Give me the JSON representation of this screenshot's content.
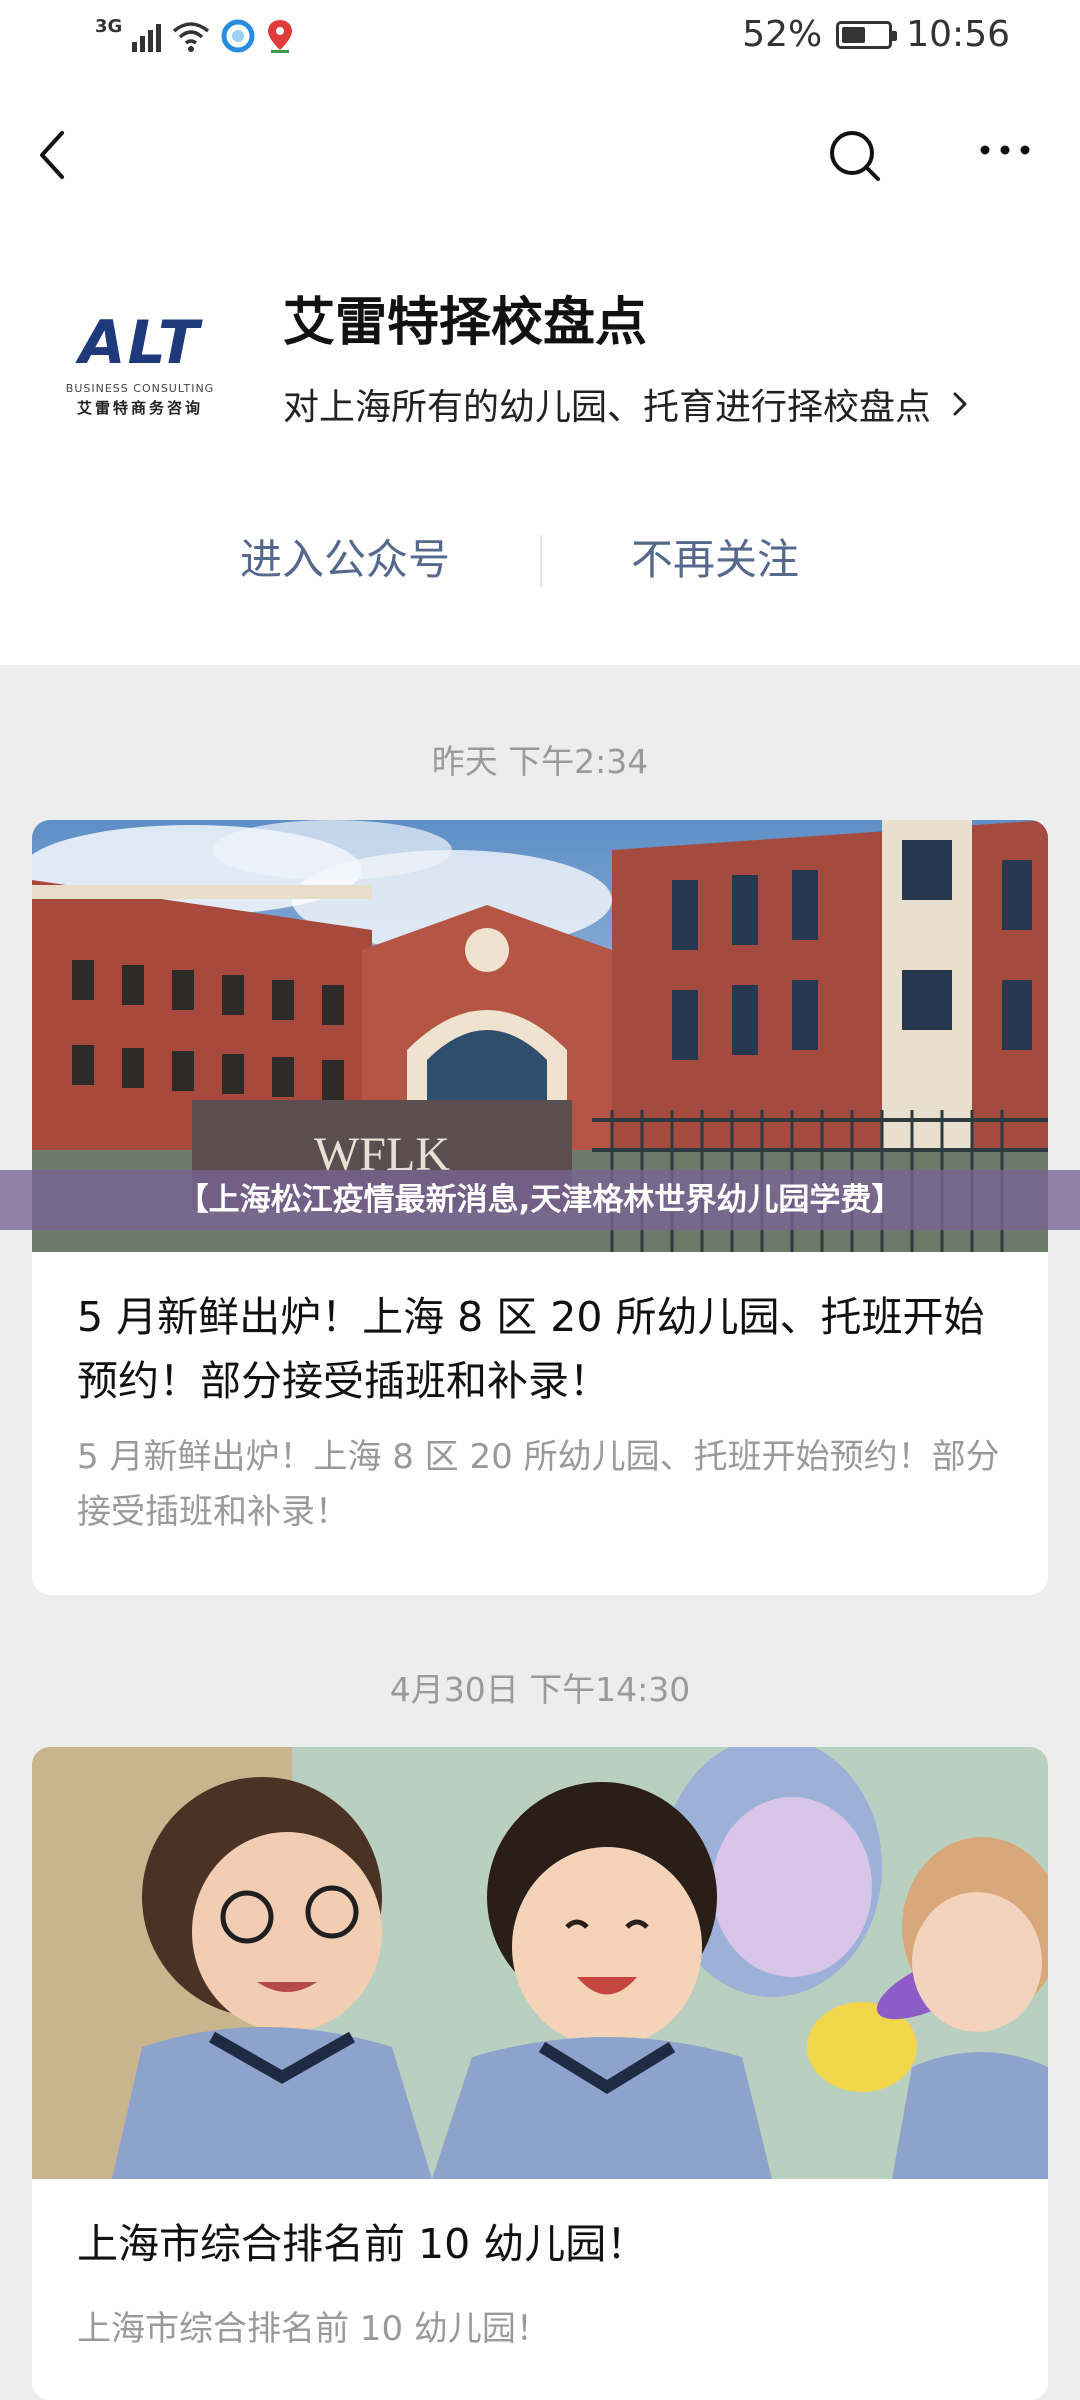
{
  "status_bar": {
    "network": "3G",
    "battery_percent": "52%",
    "battery_level": 0.52,
    "time": "10:56",
    "icons": [
      "signal-icon",
      "wifi-icon",
      "app-notification-icon",
      "location-icon",
      "battery-icon"
    ]
  },
  "header": {
    "back_icon": "chevron-left-icon",
    "search_icon": "search-icon",
    "more_icon": "more-dots-icon",
    "logo": {
      "main": "ALT",
      "sub_en": "BUSINESS CONSULTING",
      "sub_cn": "艾雷特商务咨询"
    },
    "account_name": "艾雷特择校盘点",
    "account_desc": "对上海所有的幼儿园、托育进行择校盘点",
    "enter_label": "进入公众号",
    "unfollow_label": "不再关注"
  },
  "feed": [
    {
      "timestamp": "昨天 下午2:34",
      "title": "5 月新鲜出炉！上海 8 区 20 所幼儿园、托班开始预约！部分接受插班和补录！",
      "digest": "5 月新鲜出炉！上海 8 区 20 所幼儿园、托班开始预约！部分接受插班和补录！",
      "image_sign": "WFLK"
    },
    {
      "timestamp": "4月30日 下午14:30",
      "title": "上海市综合排名前 10 幼儿园！",
      "digest": "上海市综合排名前 10 幼儿园！"
    }
  ],
  "overlay_banner": "【上海松江疫情最新消息,天津格林世界幼儿园学费】",
  "colors": {
    "link_blue": "#56698c",
    "page_bg": "#ededed",
    "banner_bg": "#78649680",
    "logo_blue": "#1e3a7b"
  }
}
